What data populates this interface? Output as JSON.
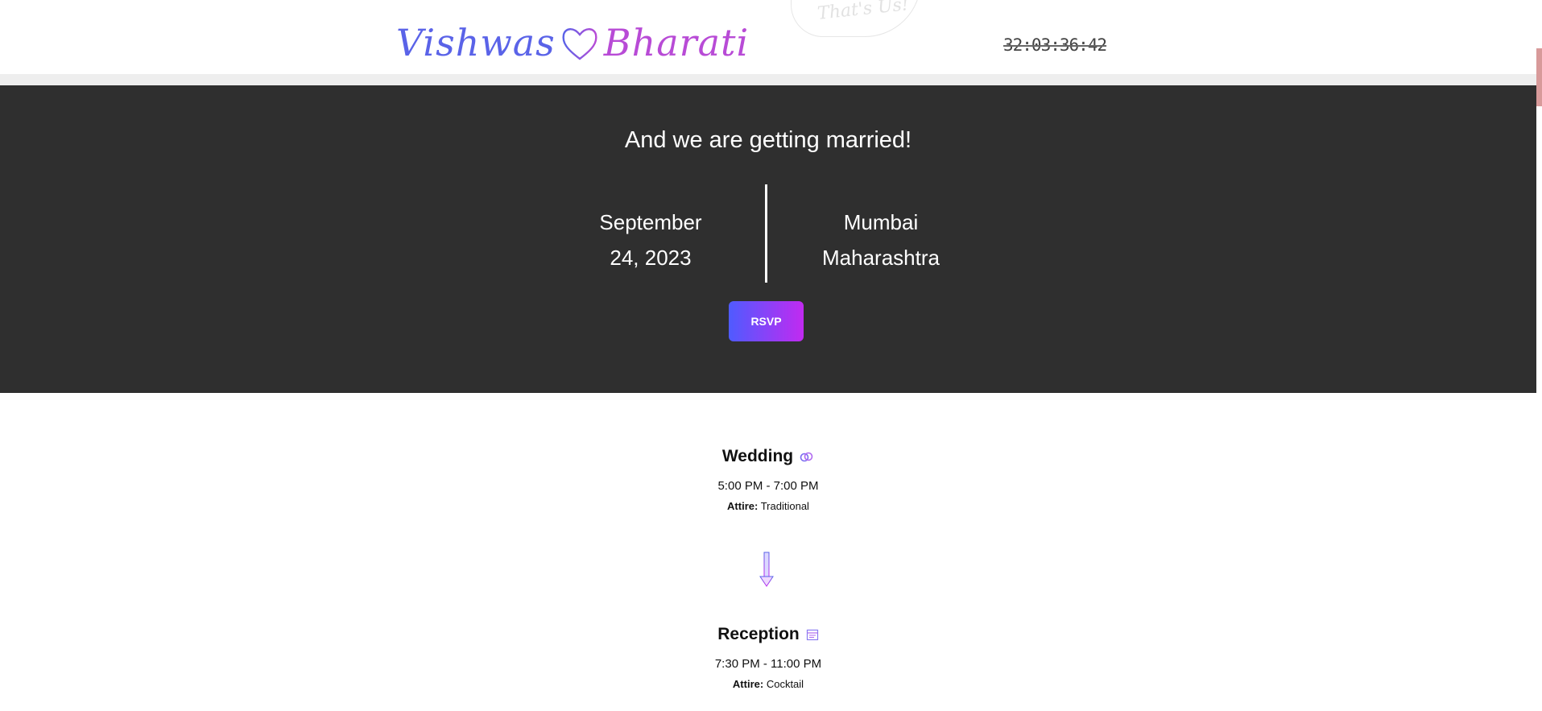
{
  "header": {
    "logo_groom": "Vishwas",
    "logo_bride": "Bharati",
    "stamp_text": "That's Us!",
    "countdown": "32:03:36:42"
  },
  "hero": {
    "title": "And we are getting married!",
    "date_line1": "September",
    "date_line2": "24, 2023",
    "place_line1": "Mumbai",
    "place_line2": "Maharashtra",
    "rsvp_label": "RSVP"
  },
  "events": [
    {
      "title": "Wedding",
      "icon": "rings-icon",
      "time": "5:00 PM - 7:00 PM",
      "attire_label": "Attire:",
      "attire_value": "Traditional"
    },
    {
      "title": "Reception",
      "icon": "calendar-icon",
      "time": "7:30 PM - 11:00 PM",
      "attire_label": "Attire:",
      "attire_value": "Cocktail"
    }
  ],
  "colors": {
    "hero_bg": "#2f2f2f",
    "brand_blue": "#4f5bff",
    "brand_purple": "#c12af0"
  }
}
